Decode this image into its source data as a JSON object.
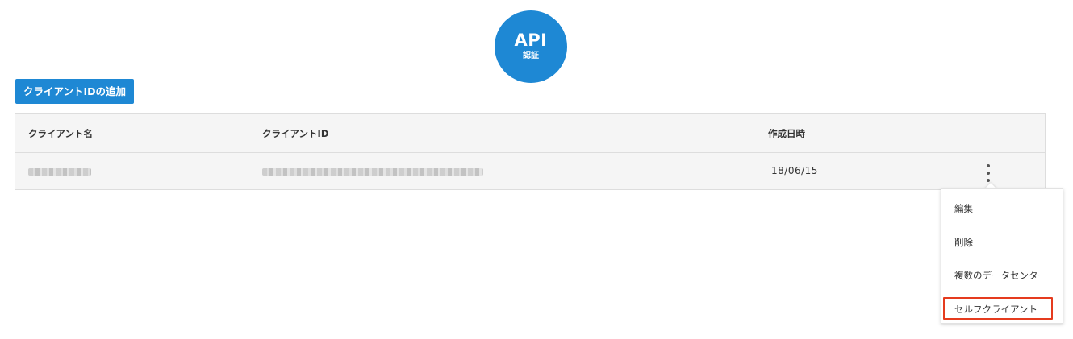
{
  "api_badge": {
    "title": "API",
    "subtitle": "認証"
  },
  "toolbar": {
    "add_client_label": "クライアントIDの追加"
  },
  "table": {
    "columns": [
      "クライアント名",
      "クライアントID",
      "作成日時"
    ],
    "rows": [
      {
        "client_name": "(blurred)",
        "client_id": "(blurred)",
        "created_at": "18/06/15"
      }
    ]
  },
  "row_menu": {
    "items": [
      "編集",
      "削除",
      "複数のデータセンター",
      "セルフクライアント"
    ],
    "highlighted_item": "セルフクライアント"
  },
  "colors": {
    "accent": "#1e88d4",
    "highlight": "#e53b1e",
    "table_bg": "#f5f5f5"
  },
  "icons": {
    "row_actions": "kebab-menu-icon"
  }
}
